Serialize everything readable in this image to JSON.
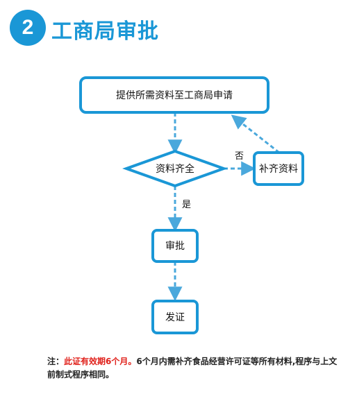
{
  "header": {
    "step_number": "2",
    "title": "工商局审批"
  },
  "diagram": {
    "nodes": {
      "submit": "提供所需资料至工商局申请",
      "check": "资料齐全",
      "supplement": "补齐资料",
      "approve": "审批",
      "issue": "发证"
    },
    "edges": {
      "no": "否",
      "yes": "是"
    }
  },
  "note": {
    "prefix": "注：",
    "highlight": "此证有效期6个月。",
    "body": "6个月内需补齐食品经营许可证等所有材料,程序与上文前制式程序相同。"
  },
  "colors": {
    "accent": "#1a97d6",
    "border": "#1a97d6",
    "arrow": "#4aa8dc",
    "highlight": "#e0211b"
  }
}
